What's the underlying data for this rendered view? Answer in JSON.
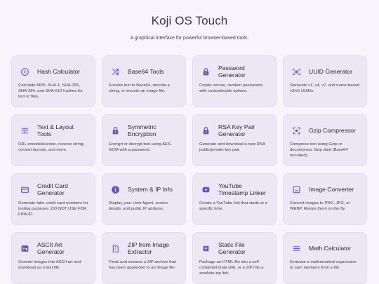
{
  "header": {
    "title": "Koji OS Touch",
    "subtitle": "A graphical interface for powerful browser-based tools."
  },
  "colors": {
    "accent": "#6a55b5",
    "card_bg": "#ece6f5",
    "page_bg": "#f7f4fb"
  },
  "tools": [
    {
      "title": "Hash Calculator",
      "desc": "Calculate MD5, SHA-1, SHA-256, SHA-384, and SHA-512 hashes for text or files.",
      "icon": "hash-circle-icon"
    },
    {
      "title": "Base64 Tools",
      "desc": "Encode text to Base64, decode a string, or encode an image file.",
      "icon": "swap-icon"
    },
    {
      "title": "Password Generator",
      "desc": "Create secure, random passwords with customizable options.",
      "icon": "lock-icon"
    },
    {
      "title": "UUID Generator",
      "desc": "Generate v1, v4, v7, and name-based v3/v5 UUIDs.",
      "icon": "barcode-icon"
    },
    {
      "title": "Text & Layout Tools",
      "desc": "URL encode/decode, reverse string, convert layouts, and more.",
      "icon": "text-align-icon"
    },
    {
      "title": "Symmetric Encryption",
      "desc": "Encrypt or decrypt text using AES-GCM with a password.",
      "icon": "lock-icon"
    },
    {
      "title": "RSA Key Pair Generator",
      "desc": "Generate and download a new RSA public/private key pair.",
      "icon": "lock-icon"
    },
    {
      "title": "Gzip Compressor",
      "desc": "Compress text using Gzip or decompress Gzip data (Base64 encoded).",
      "icon": "compress-icon"
    },
    {
      "title": "Credit Card Generator",
      "desc": "Generate fake credit card numbers for testing purposes. DO NOT USE FOR FRAUD.",
      "icon": "credit-card-icon"
    },
    {
      "title": "System & IP Info",
      "desc": "Display your User Agent, screen details, and public IP address.",
      "icon": "info-icon"
    },
    {
      "title": "YouTube Timestamp Linker",
      "desc": "Create a YouTube link that starts at a specific time.",
      "icon": "play-icon"
    },
    {
      "title": "Image Converter",
      "desc": "Convert images to PNG, JPG, or WEBP. Resize them on the fly.",
      "icon": "image-icon"
    },
    {
      "title": "ASCII Art Generator",
      "desc": "Convert images into ASCII art and download as a text file.",
      "icon": "ascii-art-icon"
    },
    {
      "title": "ZIP from Image Extractor",
      "desc": "Finds and extracts a ZIP archive that has been appended to an image file.",
      "icon": "zip-file-icon"
    },
    {
      "title": "Static File Generator",
      "desc": "Package an HTML file into a self-contained Data URI, or a ZIP into a smolsite.zip link.",
      "icon": "package-icon"
    },
    {
      "title": "Math Calculator",
      "desc": "Evaluate a mathematical expression or sum numbers from a file.",
      "icon": "menu-lines-icon"
    }
  ]
}
